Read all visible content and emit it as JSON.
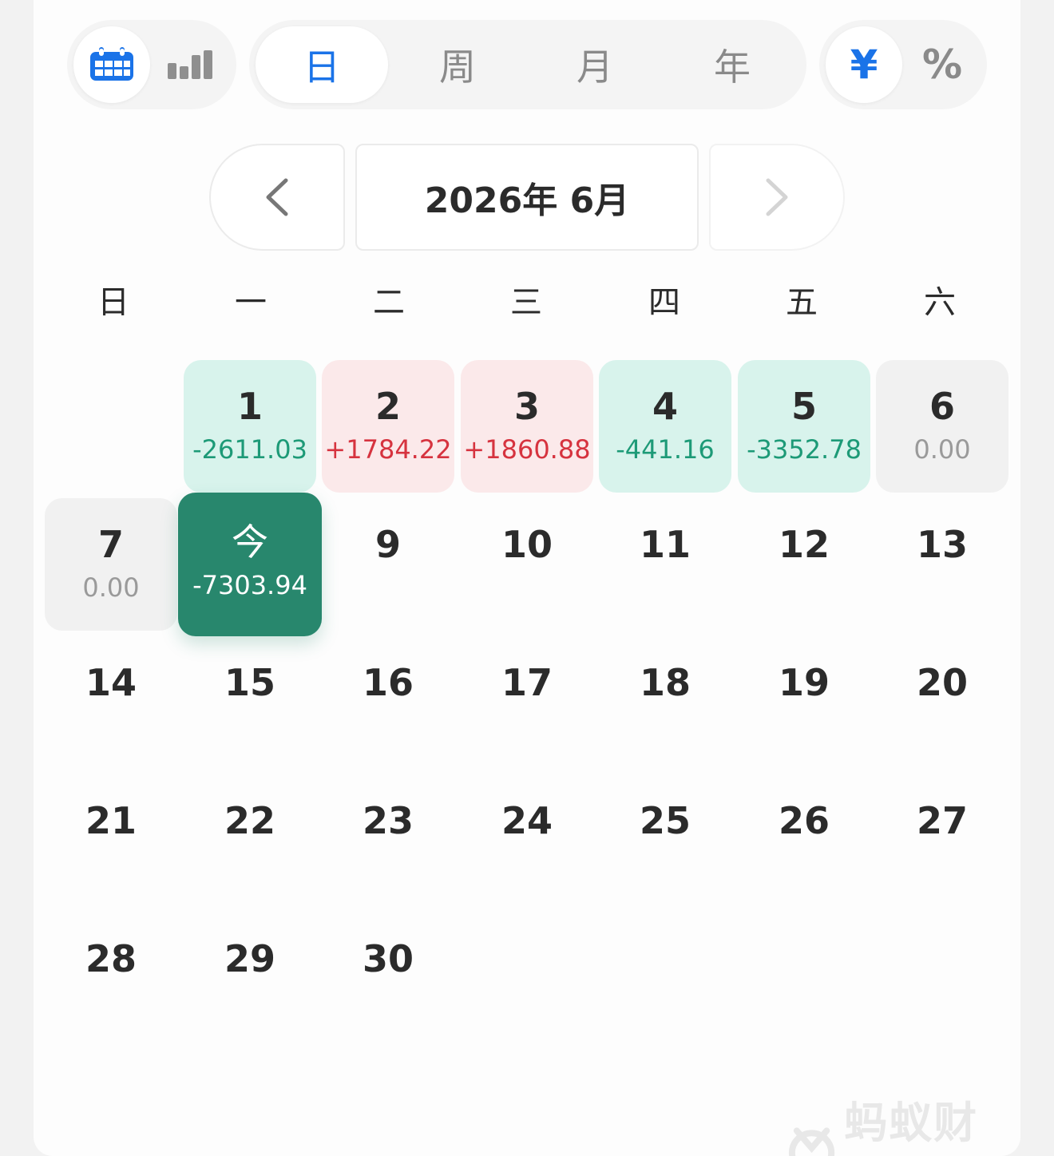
{
  "toolbar": {
    "view_icons": [
      "calendar-icon",
      "bar-chart-icon"
    ],
    "periods": [
      "日",
      "周",
      "月",
      "年"
    ],
    "active_period": "日",
    "units": [
      "¥",
      "%"
    ],
    "active_unit": "¥"
  },
  "navigator": {
    "month": "2026年 6月",
    "prev_icon": "chevron-left-icon",
    "next_icon": "chevron-right-icon"
  },
  "weekdays": [
    "日",
    "一",
    "二",
    "三",
    "四",
    "五",
    "六"
  ],
  "days": [
    {
      "label": "1",
      "amount": "-2611.03",
      "status": "loss"
    },
    {
      "label": "2",
      "amount": "+1784.22",
      "status": "gain"
    },
    {
      "label": "3",
      "amount": "+1860.88",
      "status": "gain"
    },
    {
      "label": "4",
      "amount": "-441.16",
      "status": "loss"
    },
    {
      "label": "5",
      "amount": "-3352.78",
      "status": "loss"
    },
    {
      "label": "6",
      "amount": "0.00",
      "status": "flat"
    },
    {
      "label": "7",
      "amount": "0.00",
      "status": "flat"
    },
    {
      "label": "今",
      "amount": "-7303.94",
      "status": "today"
    },
    {
      "label": "9"
    },
    {
      "label": "10"
    },
    {
      "label": "11"
    },
    {
      "label": "12"
    },
    {
      "label": "13"
    },
    {
      "label": "14"
    },
    {
      "label": "15"
    },
    {
      "label": "16"
    },
    {
      "label": "17"
    },
    {
      "label": "18"
    },
    {
      "label": "19"
    },
    {
      "label": "20"
    },
    {
      "label": "21"
    },
    {
      "label": "22"
    },
    {
      "label": "23"
    },
    {
      "label": "24"
    },
    {
      "label": "25"
    },
    {
      "label": "26"
    },
    {
      "label": "27"
    },
    {
      "label": "28"
    },
    {
      "label": "29"
    },
    {
      "label": "30"
    }
  ],
  "colors": {
    "accent": "#1a73e8",
    "loss_text": "#1d9a77",
    "loss_bg": "#d8f3ec",
    "gain_text": "#d6333f",
    "gain_bg": "#fbe9ea",
    "today_bg": "#28876d"
  },
  "watermark": {
    "text": "蚂蚁财富",
    "icon": "ant-logo-icon"
  }
}
